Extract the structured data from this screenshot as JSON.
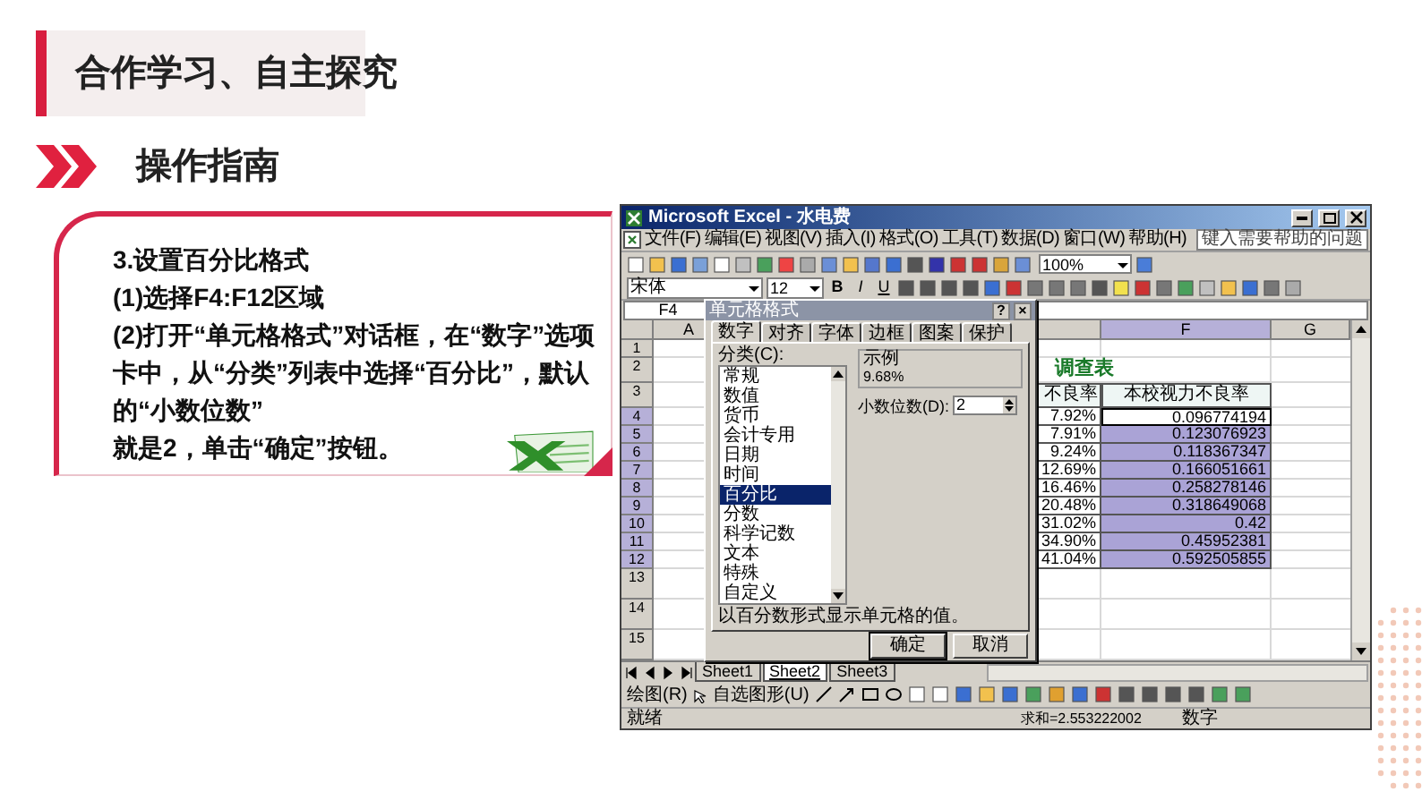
{
  "slide_title": "合作学习、自主探究",
  "section_title": "操作指南",
  "instructions": [
    "3.设置百分比格式",
    "(1)选择F4:F12区域",
    "(2)打开“单元格格式”对话框，在“数字”选项卡中，从“分类”列表中选择“百分比”，默认的“小数位数”",
    "就是2，单击“确定”按钮。"
  ],
  "excel": {
    "title": "Microsoft Excel - 水电费",
    "menus": [
      "文件(F)",
      "编辑(E)",
      "视图(V)",
      "插入(I)",
      "格式(O)",
      "工具(T)",
      "数据(D)",
      "窗口(W)",
      "帮助(H)"
    ],
    "help_prompt": "键入需要帮助的问题",
    "zoom": "100%",
    "font": "宋体",
    "font_size": "12",
    "format_buttons": [
      "B",
      "I",
      "U"
    ],
    "name_box": "F4",
    "columns": [
      {
        "label": "A",
        "selected": false
      },
      {
        "label": "F",
        "selected": true
      },
      {
        "label": "G",
        "selected": false
      }
    ],
    "rows": [
      {
        "number": "1",
        "selected": false
      },
      {
        "number": "2",
        "selected": false,
        "title": "调查表"
      },
      {
        "number": "3",
        "selected": false,
        "e": "不良率",
        "f": "本校视力不良率",
        "kind": "header"
      },
      {
        "number": "4",
        "selected": true,
        "e": "7.92%",
        "f": "0.096774194",
        "kind": "value",
        "active": true
      },
      {
        "number": "5",
        "selected": true,
        "e": "7.91%",
        "f": "0.123076923",
        "kind": "value",
        "active": false
      },
      {
        "number": "6",
        "selected": true,
        "e": "9.24%",
        "f": "0.118367347",
        "kind": "value",
        "active": false
      },
      {
        "number": "7",
        "selected": true,
        "e": "12.69%",
        "f": "0.166051661",
        "kind": "value",
        "active": false
      },
      {
        "number": "8",
        "selected": true,
        "e": "16.46%",
        "f": "0.258278146",
        "kind": "value",
        "active": false
      },
      {
        "number": "9",
        "selected": true,
        "e": "20.48%",
        "f": "0.318649068",
        "kind": "value",
        "active": false
      },
      {
        "number": "10",
        "selected": true,
        "e": "31.02%",
        "f": "0.42",
        "kind": "value",
        "active": false
      },
      {
        "number": "11",
        "selected": true,
        "e": "34.90%",
        "f": "0.45952381",
        "kind": "value",
        "active": false
      },
      {
        "number": "12",
        "selected": true,
        "e": "41.04%",
        "f": "0.592505855",
        "kind": "value",
        "active": false
      },
      {
        "number": "13",
        "selected": false
      },
      {
        "number": "14",
        "selected": false
      },
      {
        "number": "15",
        "selected": false
      }
    ],
    "sheets": [
      {
        "label": "Sheet1",
        "selected": false
      },
      {
        "label": "Sheet2",
        "selected": true
      },
      {
        "label": "Sheet3",
        "selected": false
      }
    ],
    "draw_menu": "绘图(R)",
    "autoshapes_menu": "自选图形(U)",
    "status": "就绪",
    "sum": "求和=2.553222002",
    "mode": "数字",
    "dialog": {
      "title": "单元格格式",
      "title_buttons": [
        "?",
        "×"
      ],
      "tabs": [
        {
          "label": "数字",
          "selected": true
        },
        {
          "label": "对齐",
          "selected": false
        },
        {
          "label": "字体",
          "selected": false
        },
        {
          "label": "边框",
          "selected": false
        },
        {
          "label": "图案",
          "selected": false
        },
        {
          "label": "保护",
          "selected": false
        }
      ],
      "category_label": "分类(C):",
      "categories": [
        {
          "label": "常规",
          "selected": false
        },
        {
          "label": "数值",
          "selected": false
        },
        {
          "label": "货币",
          "selected": false
        },
        {
          "label": "会计专用",
          "selected": false
        },
        {
          "label": "日期",
          "selected": false
        },
        {
          "label": "时间",
          "selected": false
        },
        {
          "label": "百分比",
          "selected": true
        },
        {
          "label": "分数",
          "selected": false
        },
        {
          "label": "科学记数",
          "selected": false
        },
        {
          "label": "文本",
          "selected": false
        },
        {
          "label": "特殊",
          "selected": false
        },
        {
          "label": "自定义",
          "selected": false
        }
      ],
      "sample_label": "示例",
      "sample": "9.68%",
      "decimal_label": "小数位数(D):",
      "decimal_value": "2",
      "description": "以百分数形式显示单元格的值。",
      "buttons": [
        "确定",
        "取消"
      ]
    }
  }
}
